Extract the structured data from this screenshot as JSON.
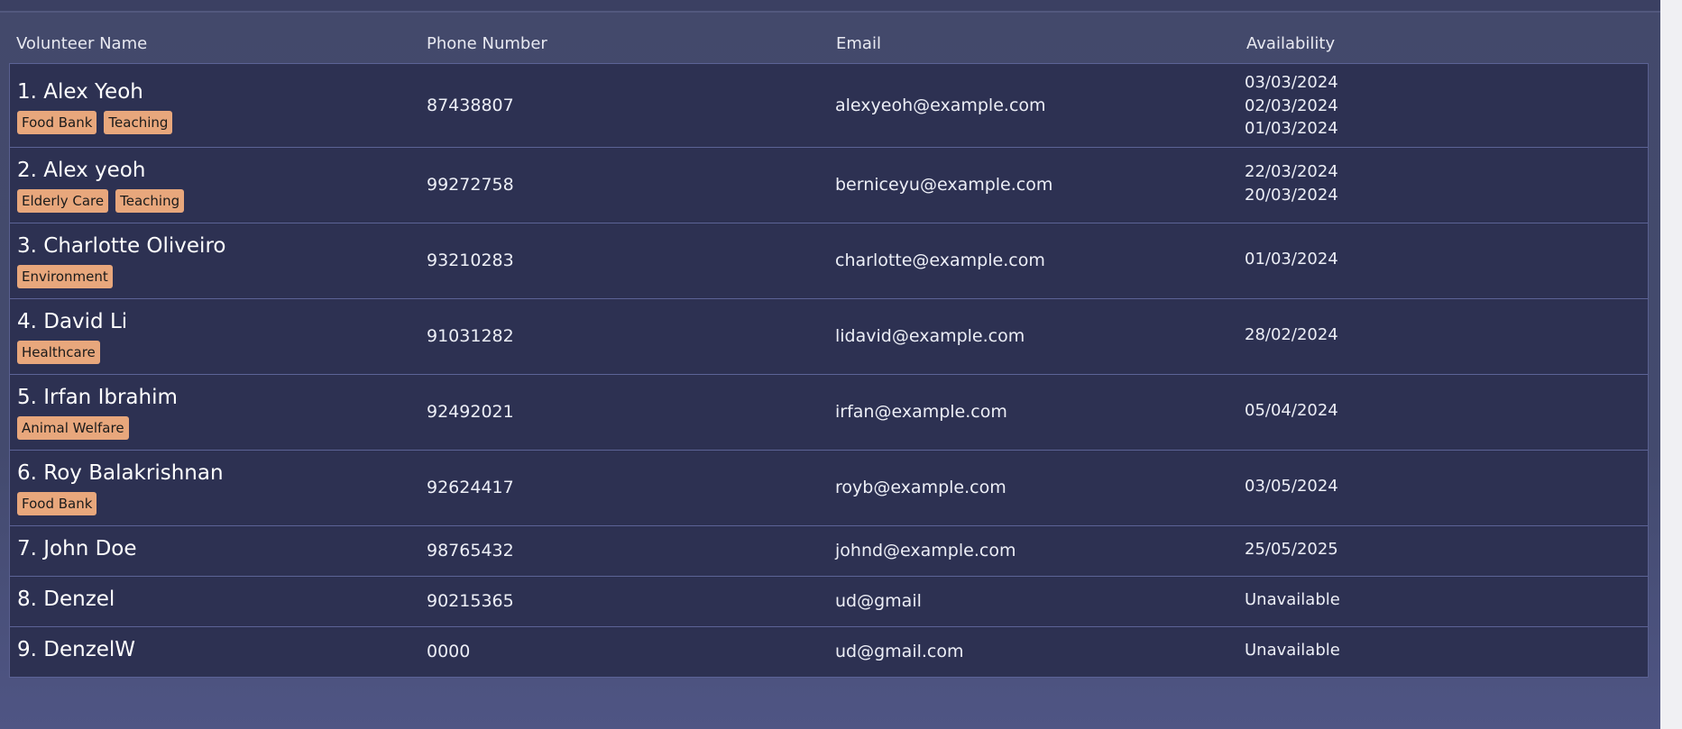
{
  "table": {
    "headers": {
      "name": "Volunteer Name",
      "phone": "Phone Number",
      "email": "Email",
      "availability": "Availability"
    },
    "rows": [
      {
        "name": "1. Alex Yeoh",
        "tags": [
          "Food Bank",
          "Teaching"
        ],
        "phone": "87438807",
        "email": "alexyeoh@example.com",
        "availability": [
          "03/03/2024",
          "02/03/2024",
          "01/03/2024"
        ]
      },
      {
        "name": "2. Alex yeoh",
        "tags": [
          "Elderly Care",
          "Teaching"
        ],
        "phone": "99272758",
        "email": "berniceyu@example.com",
        "availability": [
          "22/03/2024",
          "20/03/2024"
        ]
      },
      {
        "name": "3. Charlotte Oliveiro",
        "tags": [
          "Environment"
        ],
        "phone": "93210283",
        "email": "charlotte@example.com",
        "availability": [
          "01/03/2024"
        ]
      },
      {
        "name": "4. David Li",
        "tags": [
          "Healthcare"
        ],
        "phone": "91031282",
        "email": "lidavid@example.com",
        "availability": [
          "28/02/2024"
        ]
      },
      {
        "name": "5. Irfan Ibrahim",
        "tags": [
          "Animal Welfare"
        ],
        "phone": "92492021",
        "email": "irfan@example.com",
        "availability": [
          "05/04/2024"
        ]
      },
      {
        "name": "6. Roy Balakrishnan",
        "tags": [
          "Food Bank"
        ],
        "phone": "92624417",
        "email": "royb@example.com",
        "availability": [
          "03/05/2024"
        ]
      },
      {
        "name": "7. John Doe",
        "tags": [],
        "phone": "98765432",
        "email": "johnd@example.com",
        "availability": [
          "25/05/2025"
        ]
      },
      {
        "name": "8. Denzel",
        "tags": [],
        "phone": "90215365",
        "email": "ud@gmail",
        "availability": [
          "Unavailable"
        ]
      },
      {
        "name": "9. DenzelW",
        "tags": [],
        "phone": "0000",
        "email": "ud@gmail.com",
        "availability": [
          "Unavailable"
        ]
      }
    ]
  },
  "colors": {
    "background": "#434a6e",
    "row_background": "#2d3152",
    "row_border": "#5c6396",
    "tag_background": "#e8a77c",
    "tag_text": "#1b1b1b",
    "text": "#ffffff"
  }
}
